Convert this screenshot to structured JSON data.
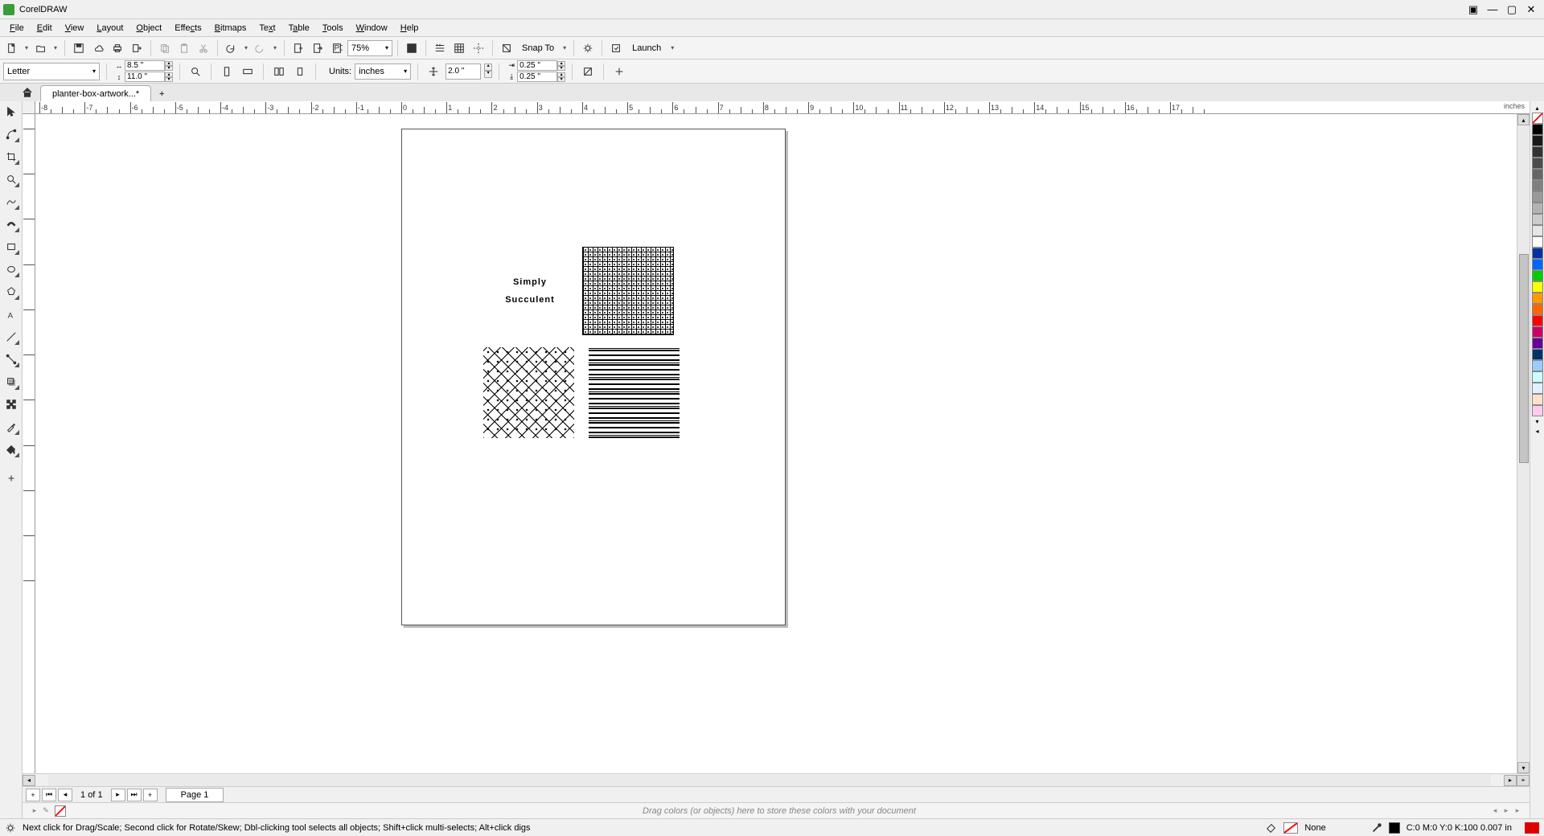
{
  "app_title": "CorelDRAW",
  "menus": [
    "File",
    "Edit",
    "View",
    "Layout",
    "Object",
    "Effects",
    "Bitmaps",
    "Text",
    "Table",
    "Tools",
    "Window",
    "Help"
  ],
  "menu_underline_idx": [
    0,
    0,
    0,
    0,
    0,
    4,
    0,
    2,
    1,
    0,
    0,
    0
  ],
  "toolbar": {
    "zoom": "75%",
    "snap_to": "Snap To",
    "launch": "Launch"
  },
  "propbar": {
    "preset": "Letter",
    "width": "8.5 \"",
    "height": "11.0 \"",
    "units_label": "Units:",
    "units": "inches",
    "nudge": "2.0 \"",
    "dup_x": "0.25 \"",
    "dup_y": "0.25 \""
  },
  "doc_tab": "planter-box-artwork...*",
  "ruler_units": "inches",
  "canvas": {
    "text_line1": "Simply",
    "text_line2": "Succulent"
  },
  "pagebar": {
    "current": "1",
    "of": "of",
    "total": "1",
    "page_label": "Page 1"
  },
  "colordock_hint": "Drag colors (or objects) here to store these colors with your document",
  "status": {
    "hint": "Next click for Drag/Scale; Second click for Rotate/Skew; Dbl-clicking tool selects all objects; Shift+click multi-selects; Alt+click digs",
    "fill_none": "None",
    "outline": "C:0 M:0 Y:0 K:100  0.007 in"
  },
  "palette_colors": [
    "#000000",
    "#1a1a1a",
    "#333333",
    "#4d4d4d",
    "#666666",
    "#808080",
    "#999999",
    "#b3b3b3",
    "#cccccc",
    "#e6e6e6",
    "#ffffff",
    "#0033a0",
    "#0066ff",
    "#00cc00",
    "#ffff00",
    "#ff9900",
    "#ff6600",
    "#ff0000",
    "#cc0066",
    "#660099",
    "#003366",
    "#99ccff",
    "#ccffff",
    "#e0f0ff",
    "#ffe0cc",
    "#ffccee"
  ]
}
